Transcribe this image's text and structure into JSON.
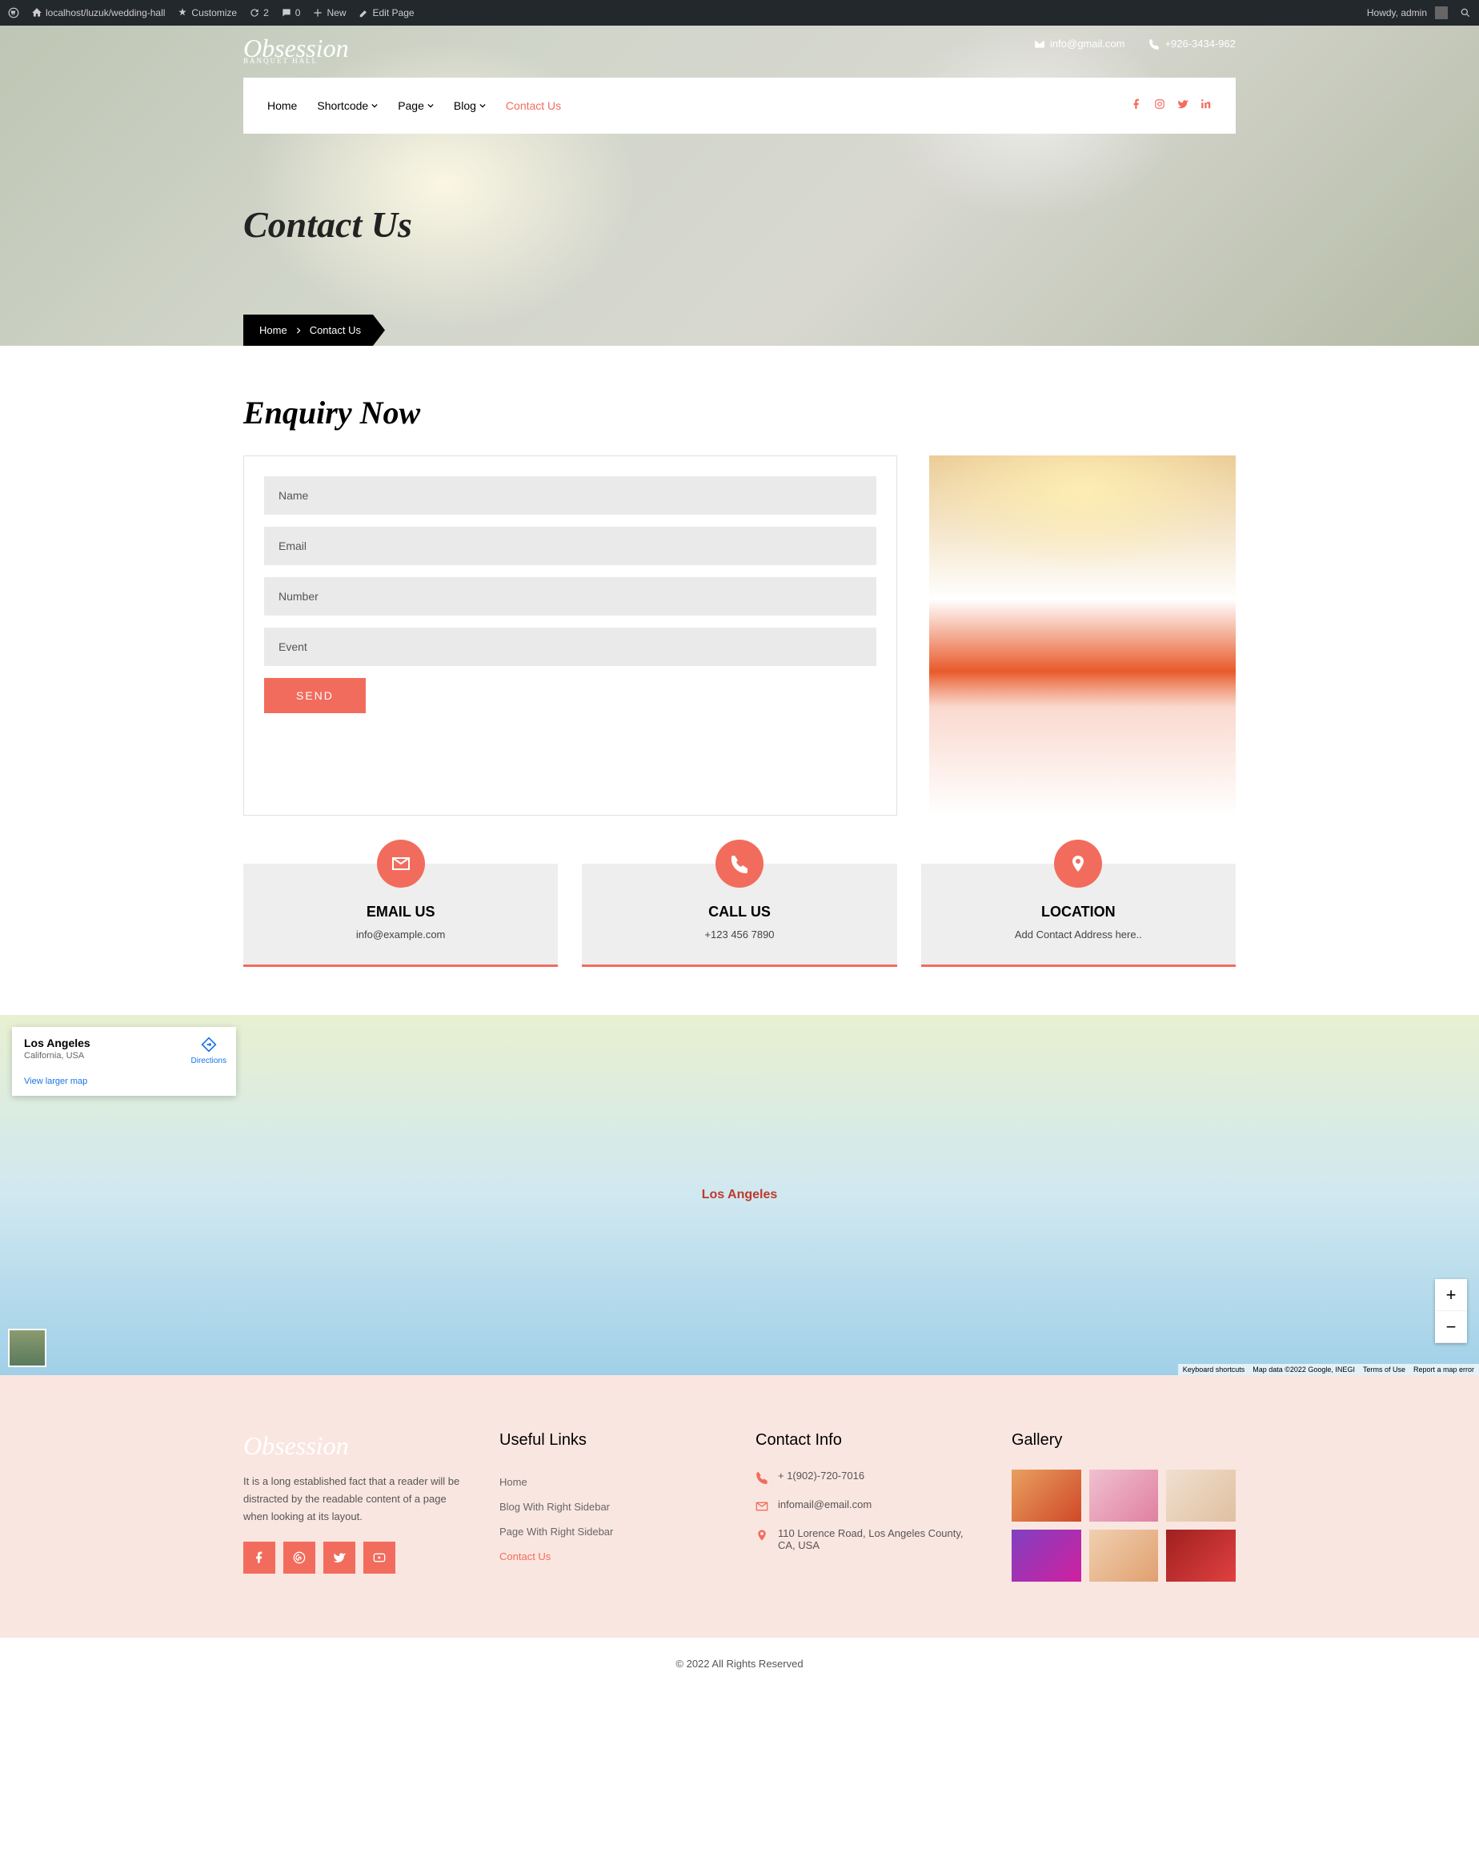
{
  "admin_bar": {
    "site": "localhost/luzuk/wedding-hall",
    "customize": "Customize",
    "updates": "2",
    "comments": "0",
    "new": "New",
    "edit": "Edit Page",
    "howdy": "Howdy, admin"
  },
  "top_contact": {
    "email": "info@gmail.com",
    "phone": "+926-3434-962"
  },
  "logo": {
    "main": "Obsession",
    "sub": "BANQUET HALL"
  },
  "nav": {
    "items": [
      {
        "label": "Home",
        "dropdown": false
      },
      {
        "label": "Shortcode",
        "dropdown": true
      },
      {
        "label": "Page",
        "dropdown": true
      },
      {
        "label": "Blog",
        "dropdown": true
      },
      {
        "label": "Contact Us",
        "dropdown": false,
        "active": true
      }
    ]
  },
  "page_title": "Contact Us",
  "breadcrumb": {
    "home": "Home",
    "current": "Contact Us"
  },
  "enquiry": {
    "title": "Enquiry Now",
    "placeholders": {
      "name": "Name",
      "email": "Email",
      "number": "Number",
      "event": "Event"
    },
    "send": "SEND"
  },
  "cards": [
    {
      "title": "EMAIL US",
      "value": "info@example.com"
    },
    {
      "title": "CALL US",
      "value": "+123 456 7890"
    },
    {
      "title": "LOCATION",
      "value": "Add Contact Address here.."
    }
  ],
  "map": {
    "city": "Los Angeles",
    "region": "California, USA",
    "directions": "Directions",
    "larger": "View larger map",
    "label": "Los Angeles",
    "attr": {
      "shortcuts": "Keyboard shortcuts",
      "data": "Map data ©2022 Google, INEGI",
      "terms": "Terms of Use",
      "report": "Report a map error"
    }
  },
  "footer": {
    "desc": "It is a long established fact that a reader will be distracted by the readable content of a page when looking at its layout.",
    "useful_title": "Useful Links",
    "useful_links": [
      {
        "label": "Home"
      },
      {
        "label": "Blog With Right Sidebar"
      },
      {
        "label": "Page With Right Sidebar"
      },
      {
        "label": "Contact Us",
        "active": true
      }
    ],
    "contact_title": "Contact Info",
    "contact": {
      "phone": "+ 1(902)-720-7016",
      "email": "infomail@email.com",
      "address": "110 Lorence Road, Los Angeles County, CA, USA"
    },
    "gallery_title": "Gallery"
  },
  "copyright": "© 2022 All Rights Reserved"
}
